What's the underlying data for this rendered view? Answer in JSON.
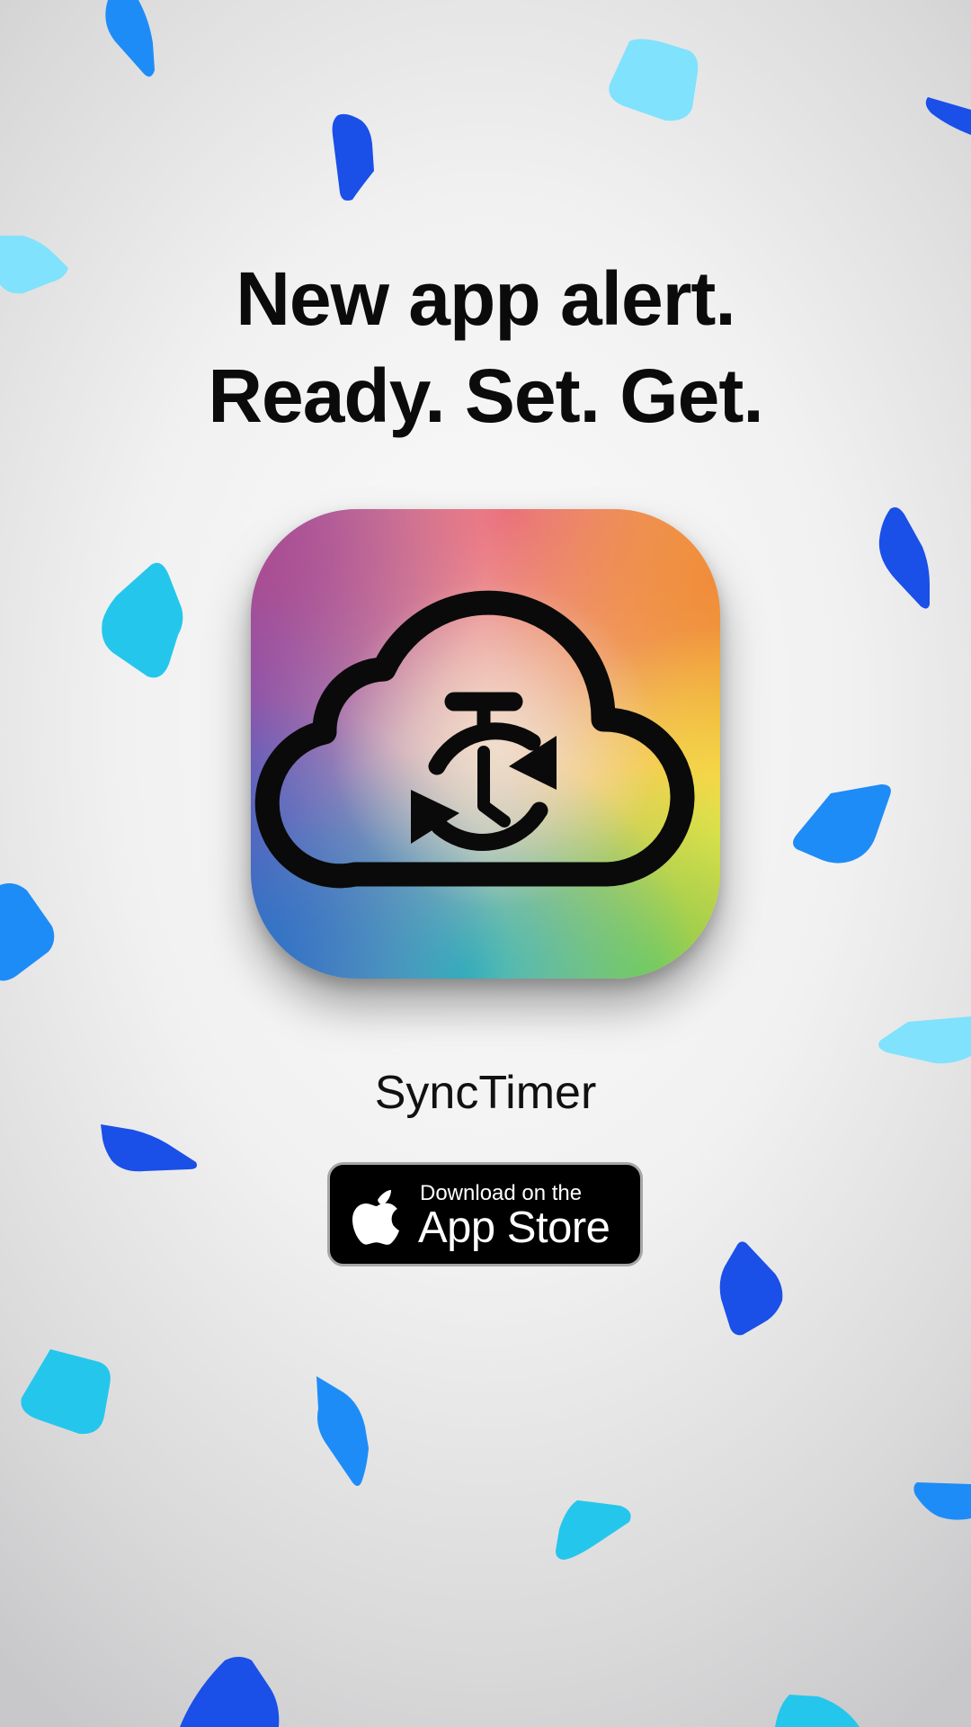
{
  "headline": {
    "line1": "New app alert.",
    "line2": "Ready. Set. Get."
  },
  "app": {
    "name": "SyncTimer",
    "icon": "cloud-stopwatch-sync-icon"
  },
  "store_badge": {
    "line1": "Download on the",
    "line2": "App Store",
    "icon": "apple-logo-icon"
  },
  "colors": {
    "confetti_dark_blue": "#1a4fe8",
    "confetti_blue": "#1e8cf7",
    "confetti_cyan": "#25c6ec",
    "confetti_light_cyan": "#80e2fc",
    "badge_background": "#000000",
    "headline_text": "#0b0b0c"
  }
}
